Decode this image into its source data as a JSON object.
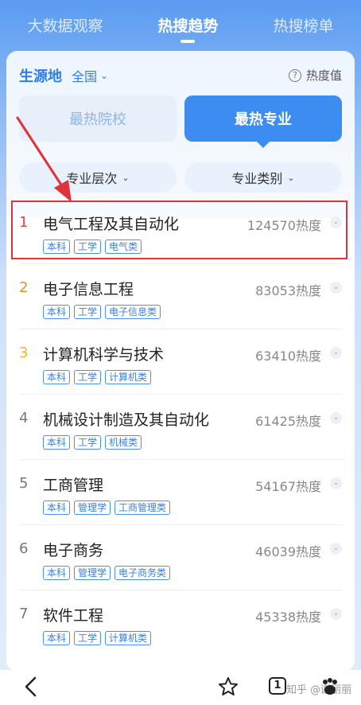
{
  "top_tabs": [
    {
      "label": "大数据观察",
      "active": false
    },
    {
      "label": "热搜趋势",
      "active": true
    },
    {
      "label": "热搜榜单",
      "active": false
    }
  ],
  "card": {
    "origin_label": "生源地",
    "region": "全国",
    "heat_help": "热度值",
    "segments": [
      "最热院校",
      "最热专业"
    ],
    "filters": [
      "专业层次",
      "专业类别"
    ]
  },
  "majors": [
    {
      "rank": "1",
      "name": "电气工程及其自动化",
      "heat": "124570热度",
      "tags": [
        "本科",
        "工学",
        "电气类"
      ]
    },
    {
      "rank": "2",
      "name": "电子信息工程",
      "heat": "83053热度",
      "tags": [
        "本科",
        "工学",
        "电子信息类"
      ]
    },
    {
      "rank": "3",
      "name": "计算机科学与技术",
      "heat": "63410热度",
      "tags": [
        "本科",
        "工学",
        "计算机类"
      ]
    },
    {
      "rank": "4",
      "name": "机械设计制造及其自动化",
      "heat": "61425热度",
      "tags": [
        "本科",
        "工学",
        "机械类"
      ]
    },
    {
      "rank": "5",
      "name": "工商管理",
      "heat": "54167热度",
      "tags": [
        "本科",
        "管理学",
        "工商管理类"
      ]
    },
    {
      "rank": "6",
      "name": "电子商务",
      "heat": "46039热度",
      "tags": [
        "本科",
        "管理学",
        "电子商务类"
      ]
    },
    {
      "rank": "7",
      "name": "软件工程",
      "heat": "45338热度",
      "tags": [
        "本科",
        "工学",
        "计算机类"
      ]
    }
  ],
  "bottom_bar": {
    "tabs_count": "1",
    "watermark": "知乎 @谢丽丽",
    "icons": [
      "back-icon",
      "star-icon",
      "tabs-icon",
      "paw-icon"
    ]
  },
  "colors": {
    "accent": "#3d8cf2",
    "rank1": "#e4473b",
    "rank2": "#f28a2b",
    "rank3": "#f3b62b",
    "annotation": "#e0323a"
  }
}
